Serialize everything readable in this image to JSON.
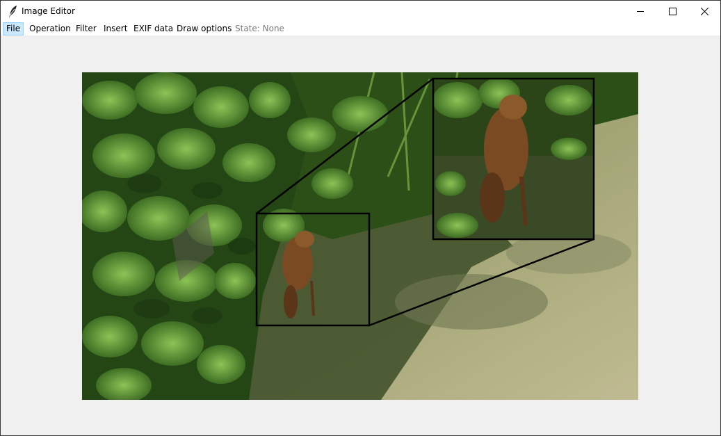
{
  "window": {
    "title": "Image Editor",
    "app_icon": "feather-icon",
    "controls": [
      "minimize-icon",
      "maximize-icon",
      "close-icon"
    ]
  },
  "menu": {
    "items": [
      {
        "label": "File",
        "active": true
      },
      {
        "label": "Operation"
      },
      {
        "label": "Filter"
      },
      {
        "label": "Insert"
      },
      {
        "label": "EXIF data"
      },
      {
        "label": "Draw options"
      }
    ],
    "state": "State: None"
  },
  "image": {
    "description_icon": "photo-image",
    "colors": {
      "foliage_dark": "#1f3f12",
      "foliage_mid": "#3f7a22",
      "foliage_light": "#7fb24a",
      "grass_shade": "#3e4f2a",
      "grass_sun": "#b7b48a",
      "animal": "#7a4a22",
      "frame": "#000000"
    }
  }
}
